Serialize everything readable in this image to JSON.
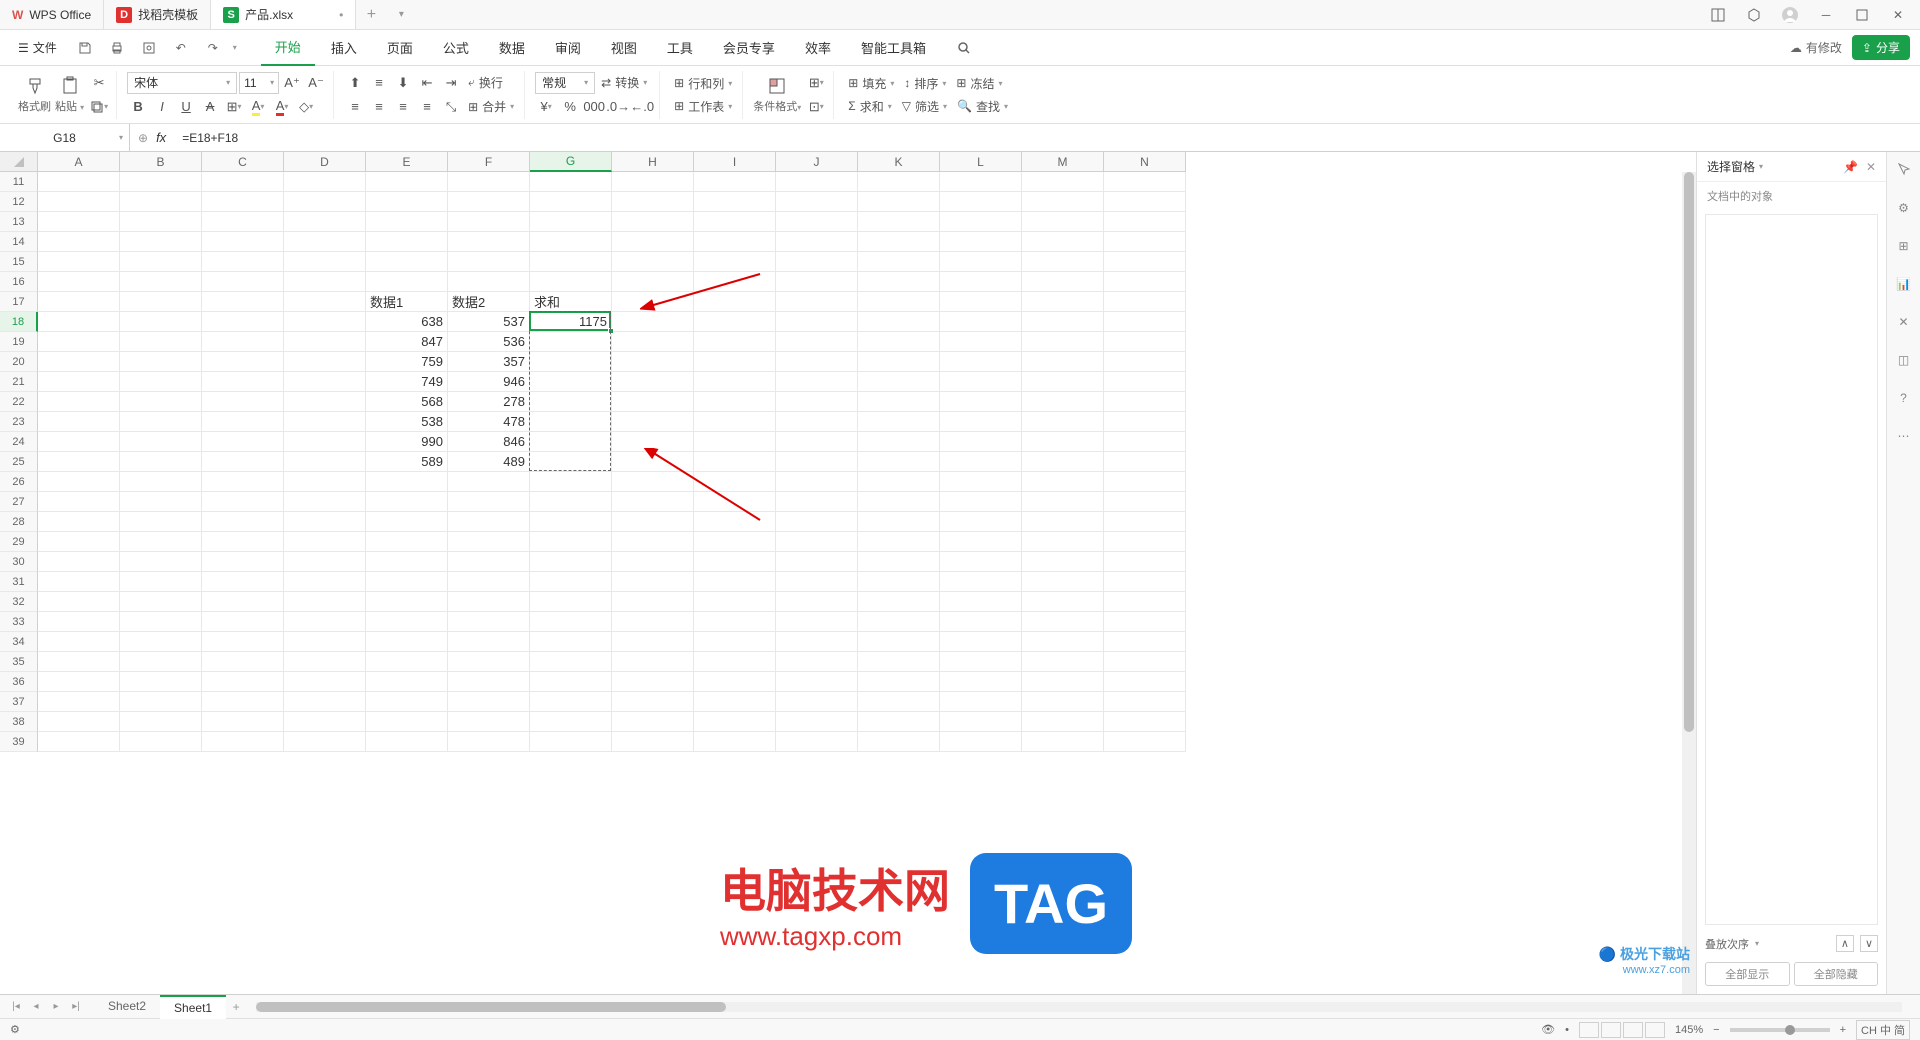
{
  "app": {
    "name": "WPS Office"
  },
  "tabs": [
    {
      "label": "找稻壳模板",
      "icon_bg": "#e03030"
    },
    {
      "label": "产品.xlsx",
      "icon_bg": "#1a9f4a",
      "icon_text": "S",
      "active": true,
      "dirty": "•"
    }
  ],
  "menu": {
    "file": "文件",
    "items": [
      "开始",
      "插入",
      "页面",
      "公式",
      "数据",
      "审阅",
      "视图",
      "工具",
      "会员专享",
      "效率",
      "智能工具箱"
    ],
    "active": "开始",
    "changes": "有修改",
    "share": "分享"
  },
  "ribbon": {
    "format_painter": "格式刷",
    "paste": "粘贴",
    "font_name": "宋体",
    "font_size": "11",
    "wrap": "换行",
    "merge": "合并",
    "number_format": "常规",
    "convert": "转换",
    "rowcol": "行和列",
    "worksheet": "工作表",
    "cond_format": "条件格式",
    "fill": "填充",
    "sort": "排序",
    "freeze": "冻结",
    "sum": "求和",
    "filter": "筛选",
    "find": "查找"
  },
  "formula_bar": {
    "cell_ref": "G18",
    "formula": "=E18+F18"
  },
  "columns": [
    "A",
    "B",
    "C",
    "D",
    "E",
    "F",
    "G",
    "H",
    "I",
    "J",
    "K",
    "L",
    "M",
    "N"
  ],
  "active_col": "G",
  "rows_start": 11,
  "rows_end": 39,
  "active_row": 18,
  "data": {
    "headers": {
      "E": "数据1",
      "F": "数据2",
      "G": "求和",
      "row": 17
    },
    "rows": [
      {
        "r": 18,
        "E": "638",
        "F": "537",
        "G": "1175"
      },
      {
        "r": 19,
        "E": "847",
        "F": "536"
      },
      {
        "r": 20,
        "E": "759",
        "F": "357"
      },
      {
        "r": 21,
        "E": "749",
        "F": "946"
      },
      {
        "r": 22,
        "E": "568",
        "F": "278"
      },
      {
        "r": 23,
        "E": "538",
        "F": "478"
      },
      {
        "r": 24,
        "E": "990",
        "F": "846"
      },
      {
        "r": 25,
        "E": "589",
        "F": "489"
      }
    ]
  },
  "panel": {
    "title": "选择窗格",
    "sub": "文档中的对象",
    "order": "叠放次序",
    "show_all": "全部显示",
    "hide_all": "全部隐藏"
  },
  "sheets": {
    "list": [
      "Sheet2",
      "Sheet1"
    ],
    "active": "Sheet1"
  },
  "status": {
    "zoom": "145%",
    "ime": "CH 中 简"
  },
  "watermark": {
    "cn": "电脑技术网",
    "url": "www.tagxp.com",
    "tag": "TAG",
    "corner1": "极光下载站",
    "corner2": "www.xz7.com"
  }
}
